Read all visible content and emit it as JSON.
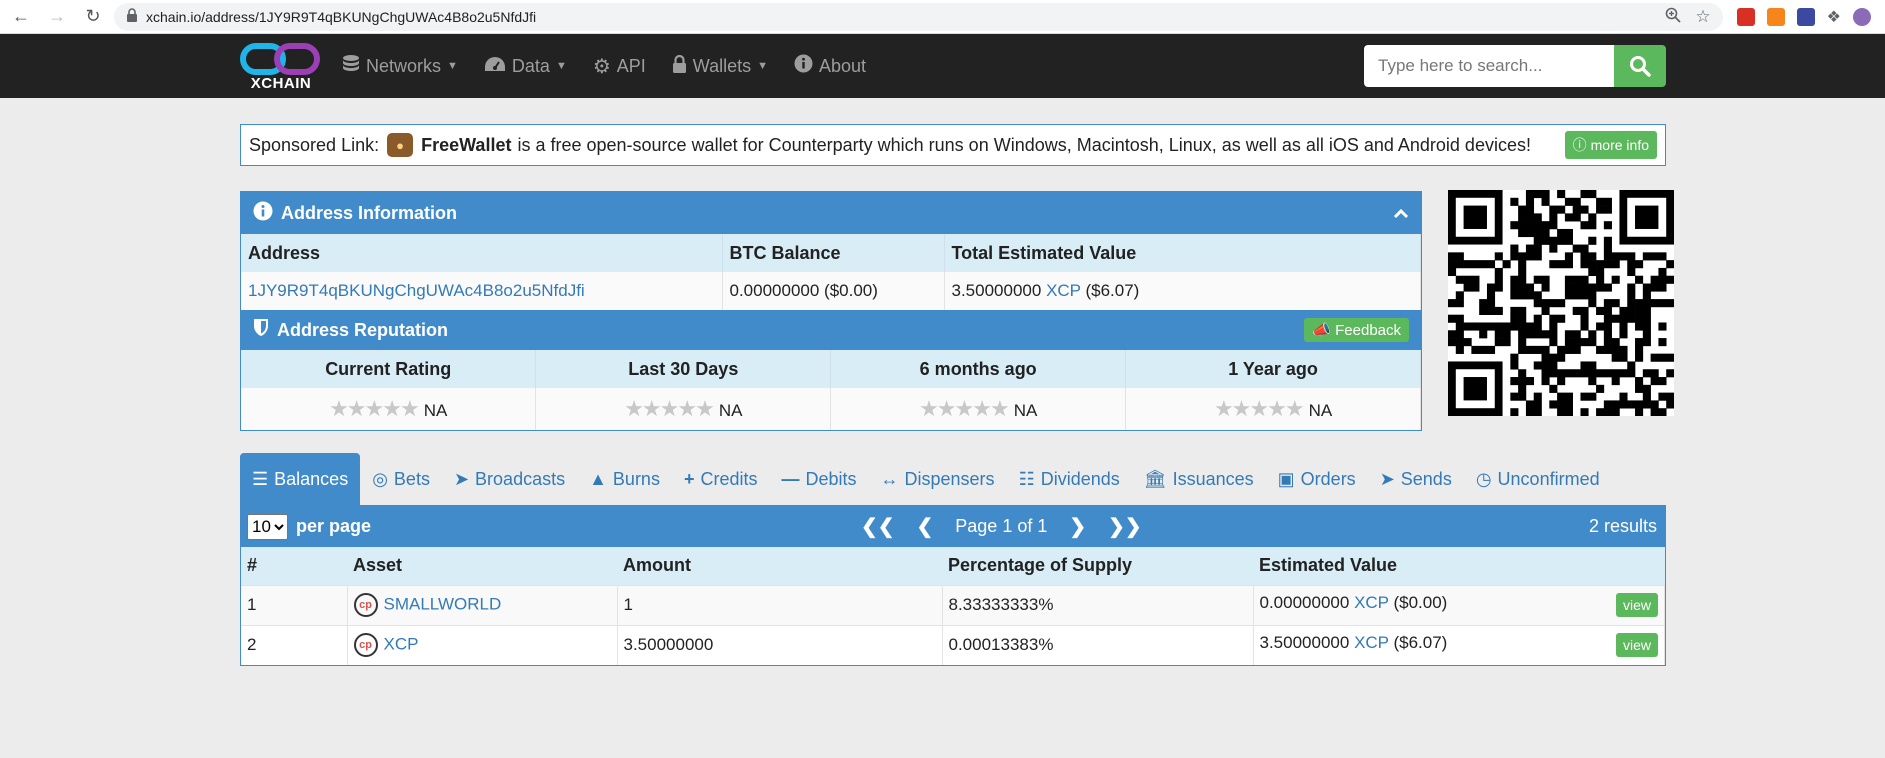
{
  "browser": {
    "url": "xchain.io/address/1JY9R9T4qBKUNgChgUWAc4B8o2u5NfdJfi"
  },
  "navbar": {
    "brand": "XCHAIN",
    "items": [
      {
        "label": "Networks",
        "icon": "database-icon",
        "dropdown": true
      },
      {
        "label": "Data",
        "icon": "dashboard-icon",
        "dropdown": true
      },
      {
        "label": "API",
        "icon": "cogs-icon",
        "dropdown": false
      },
      {
        "label": "Wallets",
        "icon": "lock-icon",
        "dropdown": true
      },
      {
        "label": "About",
        "icon": "info-icon",
        "dropdown": false
      }
    ],
    "search_placeholder": "Type here to search..."
  },
  "sponsored": {
    "prefix": "Sponsored Link:",
    "name": "FreeWallet",
    "text": "is a free open-source wallet for Counterparty which runs on Windows, Macintosh, Linux, as well as all iOS and Android devices!",
    "button": "more info"
  },
  "address_info": {
    "title": "Address Information",
    "headers": [
      "Address",
      "BTC Balance",
      "Total Estimated Value"
    ],
    "address": "1JY9R9T4qBKUNgChgUWAc4B8o2u5NfdJfi",
    "btc_balance": "0.00000000 ($0.00)",
    "total_value_amount": "3.50000000",
    "total_value_asset": "XCP",
    "total_value_usd": "($6.07)"
  },
  "reputation": {
    "title": "Address Reputation",
    "feedback": "Feedback",
    "headers": [
      "Current Rating",
      "Last 30 Days",
      "6 months ago",
      "1 Year ago"
    ],
    "values": [
      "NA",
      "NA",
      "NA",
      "NA"
    ]
  },
  "tabs": [
    {
      "label": "Balances",
      "icon": "list-icon",
      "active": true
    },
    {
      "label": "Bets",
      "icon": "target-icon"
    },
    {
      "label": "Broadcasts",
      "icon": "bullhorn-icon"
    },
    {
      "label": "Burns",
      "icon": "fire-icon"
    },
    {
      "label": "Credits",
      "icon": "plus-icon"
    },
    {
      "label": "Debits",
      "icon": "minus-icon"
    },
    {
      "label": "Dispensers",
      "icon": "arrows-h-icon"
    },
    {
      "label": "Dividends",
      "icon": "sitemap-icon"
    },
    {
      "label": "Issuances",
      "icon": "bank-icon"
    },
    {
      "label": "Orders",
      "icon": "book-icon"
    },
    {
      "label": "Sends",
      "icon": "paper-plane-icon"
    },
    {
      "label": "Unconfirmed",
      "icon": "clock-icon"
    }
  ],
  "balances": {
    "per_page_value": "10",
    "per_page_label": "per page",
    "page_label": "Page 1 of 1",
    "results": "2 results",
    "headers": [
      "#",
      "Asset",
      "Amount",
      "Percentage of Supply",
      "Estimated Value"
    ],
    "rows": [
      {
        "num": "1",
        "asset": "SMALLWORLD",
        "amount": "1",
        "pct": "8.33333333%",
        "est_amount": "0.00000000",
        "est_asset": "XCP",
        "est_usd": "($0.00)",
        "view": "view"
      },
      {
        "num": "2",
        "asset": "XCP",
        "amount": "3.50000000",
        "pct": "0.00013383%",
        "est_amount": "3.50000000",
        "est_asset": "XCP",
        "est_usd": "($6.07)",
        "view": "view"
      }
    ]
  },
  "colors": {
    "primary": "#428bca",
    "success": "#5cb85c",
    "navbar": "#222222",
    "header_bg": "#d9edf7"
  }
}
